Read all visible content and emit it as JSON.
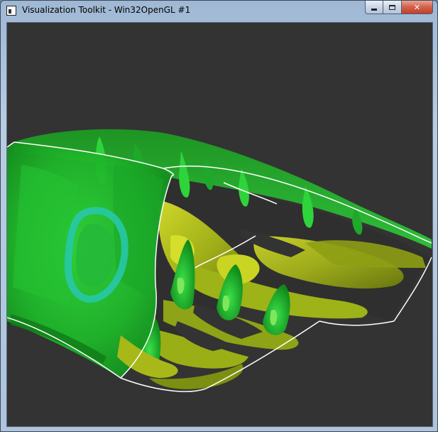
{
  "window": {
    "title": "Visualization Toolkit - Win32OpenGL #1"
  },
  "caption_buttons": {
    "minimize": "minimize-icon",
    "maximize": "maximize-icon",
    "close_label": "✕"
  },
  "icons": {
    "app": "window-icon"
  },
  "colors": {
    "background": "#333333",
    "outline": "#ffffff",
    "surface_green": "#22c02a",
    "surface_yellow": "#b8c81c",
    "surface_cyan": "#22c8a8"
  }
}
